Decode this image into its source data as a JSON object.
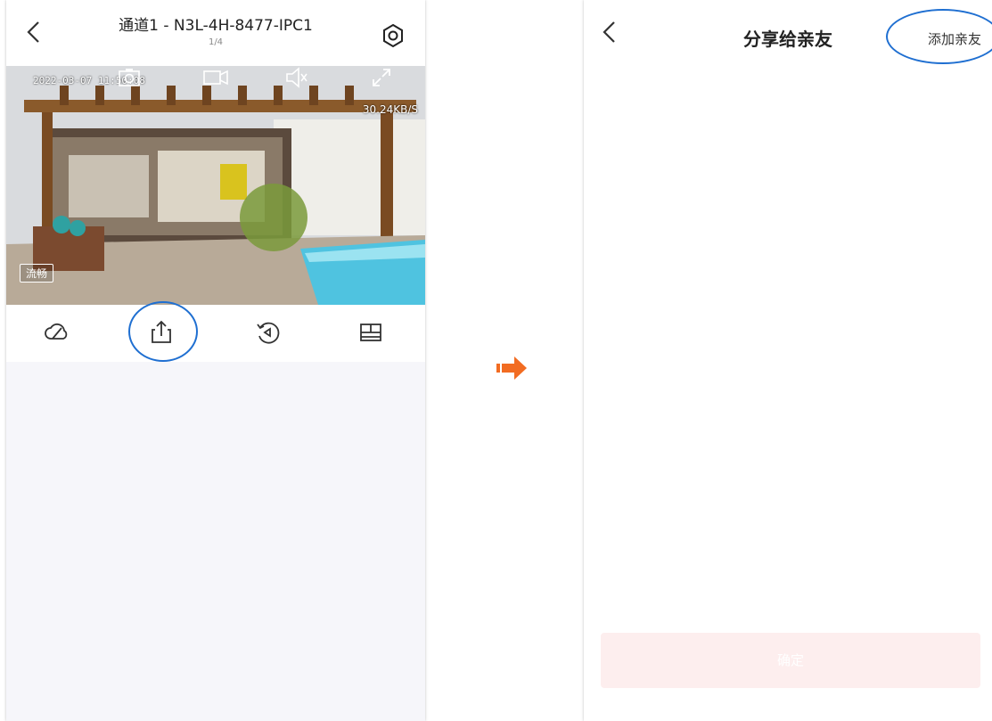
{
  "left": {
    "title": "通道1 - N3L-4H-8477-IPC1",
    "page_indicator": "1/4",
    "video": {
      "timestamp": "2022-03-07 11:50:08",
      "bitrate": "30.24KB/S",
      "quality_label": "流畅"
    },
    "toolbar_icons": [
      "cloud-icon",
      "share-icon",
      "playback-icon",
      "multiview-icon"
    ]
  },
  "right": {
    "title": "分享给亲友",
    "add_friend_label": "添加亲友",
    "confirm_label": "确定"
  },
  "colors": {
    "highlight": "#1f6fd1",
    "arrow": "#f26c22",
    "confirm_bg": "#fdeeee"
  }
}
